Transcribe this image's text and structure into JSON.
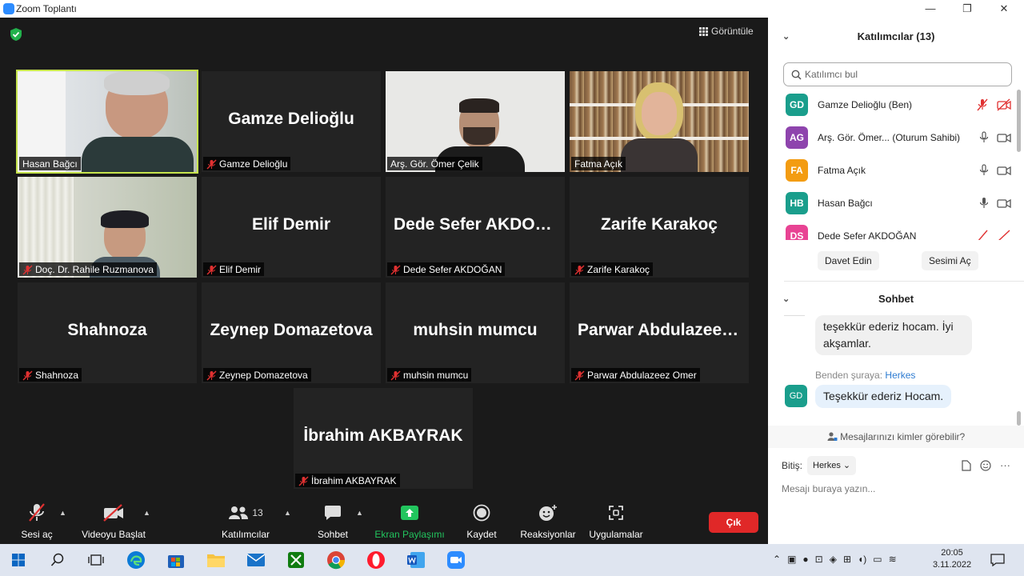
{
  "window": {
    "title": "Zoom Toplantı",
    "minimize": "—",
    "restore": "❐",
    "close": "✕"
  },
  "meeting": {
    "view_label": "Görüntüle",
    "tiles": [
      {
        "big": "",
        "label": "Hasan Bağcı",
        "muted": false,
        "video": true
      },
      {
        "big": "Gamze Delioğlu",
        "label": "Gamze Delioğlu",
        "muted": true,
        "video": false
      },
      {
        "big": "",
        "label": "Arş. Gör. Ömer Çelik",
        "muted": false,
        "video": true
      },
      {
        "big": "",
        "label": "Fatma Açık",
        "muted": false,
        "video": true
      },
      {
        "big": "",
        "label": "Doç. Dr. Rahile Ruzmanova",
        "muted": true,
        "video": true
      },
      {
        "big": "Elif Demir",
        "label": "Elif Demir",
        "muted": true,
        "video": false
      },
      {
        "big": "Dede Sefer AKDOĞAN",
        "label": "Dede Sefer AKDOĞAN",
        "muted": true,
        "video": false
      },
      {
        "big": "Zarife Karakoç",
        "label": "Zarife Karakoç",
        "muted": true,
        "video": false
      },
      {
        "big": "Shahnoza",
        "label": "Shahnoza",
        "muted": true,
        "video": false
      },
      {
        "big": "Zeynep Domazetova",
        "label": "Zeynep Domazetova",
        "muted": true,
        "video": false
      },
      {
        "big": "muhsin mumcu",
        "label": "muhsin mumcu",
        "muted": true,
        "video": false
      },
      {
        "big": "Parwar Abdulazeez Omer",
        "label": "Parwar Abdulazeez Omer",
        "muted": true,
        "video": false
      },
      {
        "big": "İbrahim AKBAYRAK",
        "label": "İbrahim AKBAYRAK",
        "muted": true,
        "video": false
      }
    ]
  },
  "toolbar": {
    "unmute": "Sesi aç",
    "start_video": "Videoyu Başlat",
    "participants": "Katılımcılar",
    "participants_count": "13",
    "chat": "Sohbet",
    "share": "Ekran Paylaşımı",
    "record": "Kaydet",
    "reactions": "Reaksiyonlar",
    "apps": "Uygulamalar",
    "leave": "Çık",
    "share_color": "#22c55e"
  },
  "participants_panel": {
    "title": "Katılımcılar (13)",
    "search_placeholder": "Katılımcı bul",
    "list": [
      {
        "initials": "GD",
        "name": "Gamze Delioğlu (Ben)",
        "color": "#1a9e8c"
      },
      {
        "initials": "AG",
        "name": "Arş. Gör. Ömer... (Oturum Sahibi)",
        "color": "#8e44ad"
      },
      {
        "initials": "FA",
        "name": "Fatma Açık",
        "color": "#f39c12"
      },
      {
        "initials": "HB",
        "name": "Hasan Bağcı",
        "color": "#1a9e8c"
      },
      {
        "initials": "DS",
        "name": "Dede Sefer AKDOĞAN",
        "color": "#e84393"
      }
    ],
    "invite": "Davet Edin",
    "unmute_me": "Sesimi Aç"
  },
  "chat_panel": {
    "title": "Sohbet",
    "messages": [
      {
        "text": "teşekkür ederiz hocam. İyi akşamlar."
      },
      {
        "from": "Benden şuraya:",
        "to": "Herkes",
        "avatar": "GD",
        "text": "Teşekkür ederiz Hocam."
      }
    ],
    "visibility": "Mesajlarınızı kimler görebilir?",
    "to_label": "Bitiş:",
    "to_value": "Herkes",
    "placeholder": "Mesajı buraya yazın..."
  },
  "taskbar": {
    "time": "20:05",
    "date": "3.11.2022"
  }
}
